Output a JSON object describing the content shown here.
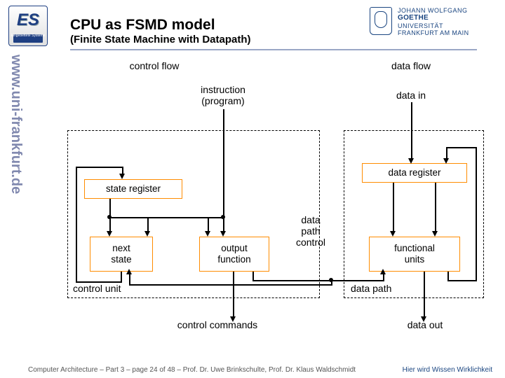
{
  "header": {
    "title": "CPU as FSMD model",
    "subtitle": "(Finite State Machine with Datapath)"
  },
  "labels": {
    "control_flow": "control flow",
    "data_flow": "data flow",
    "instruction": "instruction",
    "program": "(program)",
    "data_in": "data in",
    "state_register": "state register",
    "data_register": "data register",
    "next_state": "next\nstate",
    "output_function": "output\nfunction",
    "functional_units": "functional\nunits",
    "control_unit": "control unit",
    "data_path": "data path",
    "data_path_control": "data\npath\ncontrol",
    "control_commands": "control commands",
    "data_out": "data out"
  },
  "uni": {
    "line1": "JOHANN WOLFGANG",
    "line2": "GOETHE",
    "line3": "UNIVERSITÄT",
    "line4": "FRANKFURT AM MAIN"
  },
  "es_caption": "Eingebettete Systeme",
  "footer": "Computer Architecture – Part 3 – page 24 of 48 – Prof. Dr. Uwe Brinkschulte, Prof. Dr. Klaus Waldschmidt",
  "motto": "Hier wird Wissen Wirklichkeit"
}
